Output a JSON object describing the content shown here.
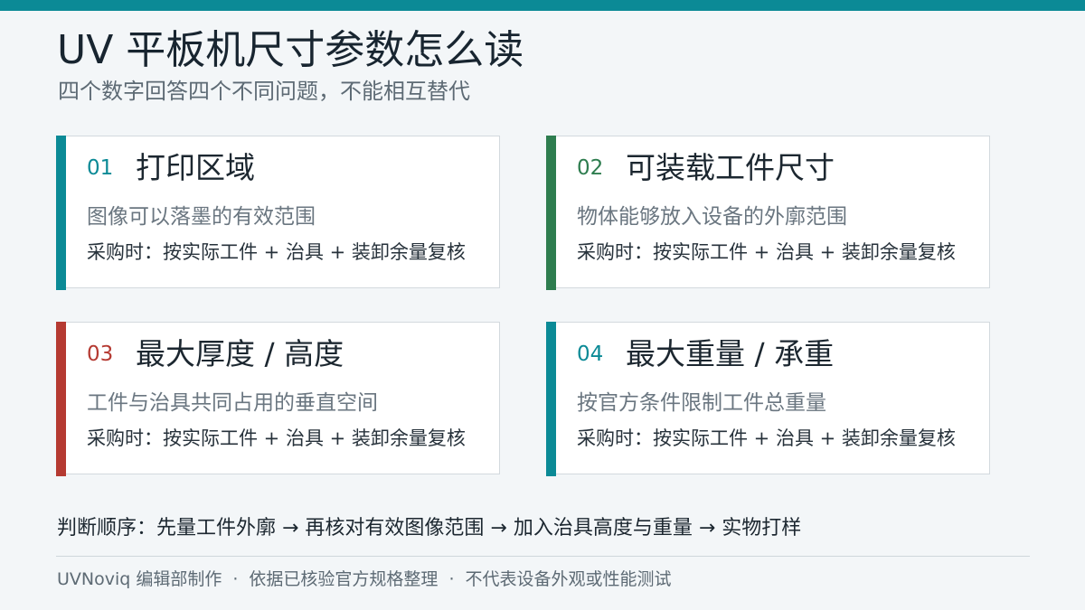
{
  "header": {
    "title": "UV 平板机尺寸参数怎么读",
    "subtitle": "四个数字回答四个不同问题，不能相互替代"
  },
  "colors": {
    "top_bar": "#0b8a96",
    "teal": "#0b8a96",
    "green": "#2e7d4f",
    "red": "#b53a32"
  },
  "cards": [
    {
      "number": "01",
      "heading": "打印区域",
      "description": "图像可以落墨的有效范围",
      "note": "采购时：按实际工件 + 治具 + 装卸余量复核",
      "accent": "#0b8a96"
    },
    {
      "number": "02",
      "heading": "可装载工件尺寸",
      "description": "物体能够放入设备的外廓范围",
      "note": "采购时：按实际工件 + 治具 + 装卸余量复核",
      "accent": "#2e7d4f"
    },
    {
      "number": "03",
      "heading": "最大厚度 / 高度",
      "description": "工件与治具共同占用的垂直空间",
      "note": "采购时：按实际工件 + 治具 + 装卸余量复核",
      "accent": "#b53a32"
    },
    {
      "number": "04",
      "heading": "最大重量 / 承重",
      "description": "按官方条件限制工件总重量",
      "note": "采购时：按实际工件 + 治具 + 装卸余量复核",
      "accent": "#0b8a96"
    }
  ],
  "sequence": "判断顺序：先量工件外廓 → 再核对有效图像范围 → 加入治具高度与重量 → 实物打样",
  "footer": {
    "parts": [
      "UVNoviq 编辑部制作",
      "依据已核验官方规格整理",
      "不代表设备外观或性能测试"
    ],
    "separator": "·"
  }
}
